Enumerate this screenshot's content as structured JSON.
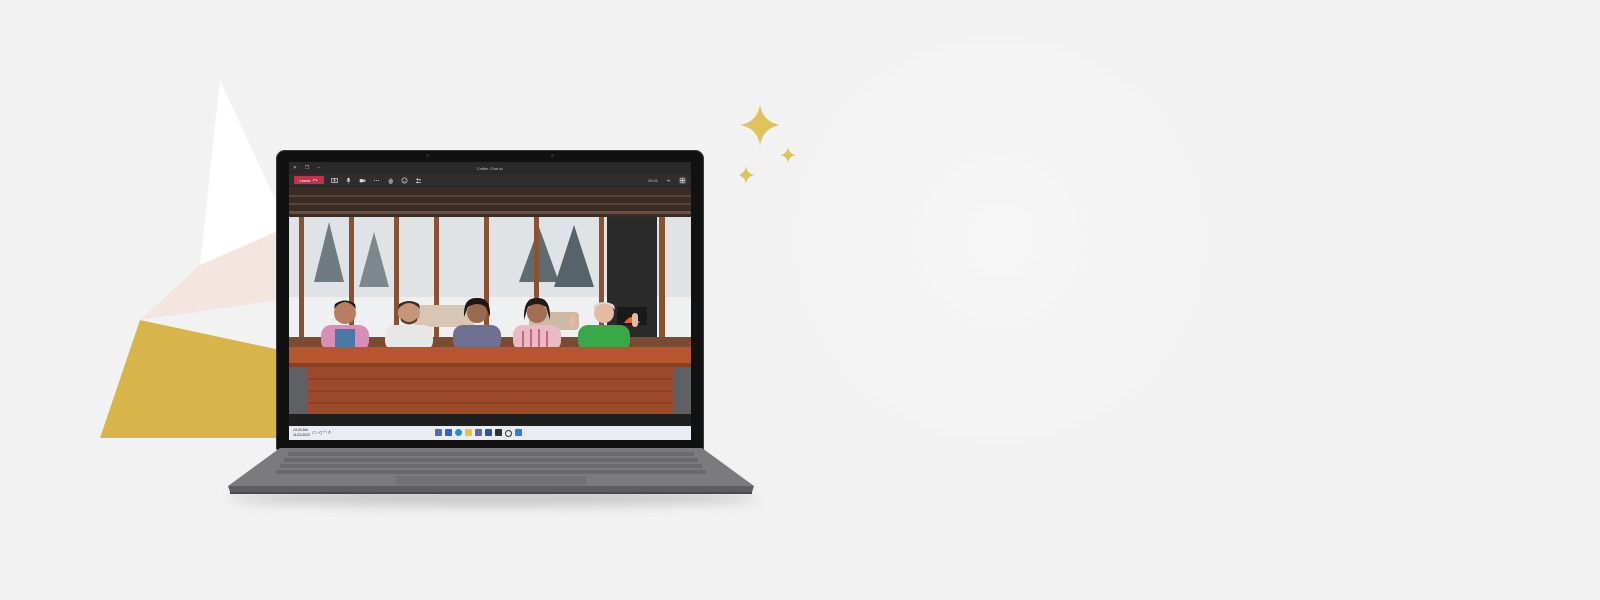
{
  "meeting": {
    "window_title": "Coffee Chat sc",
    "leave_label": "Leave",
    "timer": "00:11"
  },
  "window_controls": [
    "close-icon",
    "restore-icon",
    "minimize-icon"
  ],
  "toolbar_icons": [
    "share-icon",
    "mic-icon",
    "camera-icon",
    "more-icon",
    "raise-hand-icon",
    "react-icon",
    "people-icon"
  ],
  "taskbar": {
    "time": "10:20 AM",
    "date": "11/21/2022",
    "apps": [
      "widgets",
      "file-explorer",
      "edge",
      "folder",
      "teams",
      "word",
      "store",
      "search",
      "start"
    ]
  },
  "colors": {
    "leave_button": "#c4314b",
    "gold": "#d9b84c",
    "blush": "#f2e4df",
    "background": "#f2f2f2"
  },
  "participants": [
    {
      "shirt": "#d98fb5"
    },
    {
      "shirt": "#e7e7e7"
    },
    {
      "shirt": "#6f6f8f"
    },
    {
      "shirt": "#e9b9c4"
    },
    {
      "shirt": "#39a84a"
    }
  ]
}
